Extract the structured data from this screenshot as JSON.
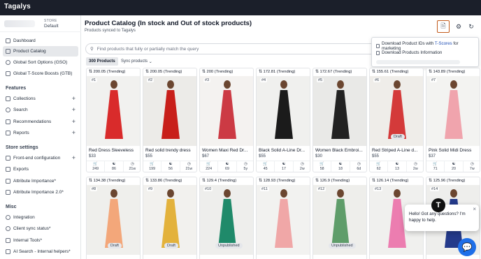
{
  "app": {
    "logo": "Tagalys"
  },
  "store": {
    "caption": "STORE",
    "value": "Default"
  },
  "sidebar": {
    "items": [
      {
        "label": "Dashboard"
      },
      {
        "label": "Product Catalog",
        "active": true
      },
      {
        "label": "Global Sort Options (GSO)"
      },
      {
        "label": "Global T-Score Boosts (GTB)"
      }
    ],
    "features_heading": "Features",
    "features": [
      {
        "label": "Collections"
      },
      {
        "label": "Search"
      },
      {
        "label": "Recommendations"
      },
      {
        "label": "Reports"
      }
    ],
    "settings_heading": "Store settings",
    "settings": [
      {
        "label": "Front-end configuration"
      },
      {
        "label": "Exports"
      },
      {
        "label": "Attribute Importance*"
      },
      {
        "label": "Attribute Importance 2.0*"
      }
    ],
    "misc_heading": "Misc",
    "misc": [
      {
        "label": "Integration"
      },
      {
        "label": "Client sync status*"
      },
      {
        "label": "Internal Tools*"
      },
      {
        "label": "AI Search - Internal helpers*"
      }
    ]
  },
  "header": {
    "title": "Product Catalog (In stock and Out of stock products)",
    "subtitle": "Products synced to Tagalys"
  },
  "dropdown": {
    "item1_prefix": "Download Product IDs with ",
    "item1_highlight": "T-Scores",
    "item1_suffix": " for marketing",
    "item2": "Download Products Information"
  },
  "search": {
    "placeholder": "Find products that fully or partially match the query"
  },
  "toolbar": {
    "count": "300 Products",
    "sync": "Sync products"
  },
  "products": [
    {
      "score": "200.05 (Trending)",
      "rank": "#1",
      "name": "Red Dress Sleeveless",
      "price": "$33",
      "stats": [
        "249",
        "86",
        "21w"
      ],
      "color": "#d92b2b",
      "bg": "#f1f1ef",
      "draft": ""
    },
    {
      "score": "200.05 (Trending)",
      "rank": "#2",
      "name": "Red solid trendy dress",
      "price": "$55",
      "stats": [
        "199",
        "56",
        "21w"
      ],
      "color": "#c81f1a",
      "bg": "#ecebe8",
      "draft": ""
    },
    {
      "score": "200 (Trending)",
      "rank": "#3",
      "name": "Women Maxi Red Dr...",
      "price": "$67",
      "stats": [
        "224",
        "69",
        "5y"
      ],
      "color": "#cc3a44",
      "bg": "#f4f2f0",
      "draft": ""
    },
    {
      "score": "172.81 (Trending)",
      "rank": "#4",
      "name": "Black Solid A-Line Dr...",
      "price": "$55",
      "stats": [
        "45",
        "17",
        "2w"
      ],
      "color": "#1b1b1b",
      "bg": "#f0f0ee",
      "draft": ""
    },
    {
      "score": "172.67 (Trending)",
      "rank": "#5",
      "name": "Women Black Embroi...",
      "price": "$30",
      "stats": [
        "58",
        "18",
        "6d"
      ],
      "color": "#222222",
      "bg": "#e9e9e7",
      "draft": ""
    },
    {
      "score": "155.61 (Trending)",
      "rank": "#6",
      "name": "Red Striped A-Line d...",
      "price": "$55",
      "stats": [
        "62",
        "13",
        "2w"
      ],
      "color": "#d43a3a",
      "bg": "#efede9",
      "draft": "Draft"
    },
    {
      "score": "143.89 (Trending)",
      "rank": "#7",
      "name": "Pink Solid Midi Dress",
      "price": "$37",
      "stats": [
        "71",
        "20",
        "7w"
      ],
      "color": "#f0a4ad",
      "bg": "#f3f3f1",
      "draft": ""
    },
    {
      "score": "134.38 (Trending)",
      "rank": "#8",
      "name": "",
      "price": "",
      "stats": [],
      "color": "#f3a77a",
      "bg": "#efefec",
      "draft": "Draft"
    },
    {
      "score": "133.86 (Trending)",
      "rank": "#9",
      "name": "",
      "price": "",
      "stats": [],
      "color": "#e3b23c",
      "bg": "#f2f1ee",
      "draft": "Draft"
    },
    {
      "score": "129.4 (Trending)",
      "rank": "#10",
      "name": "",
      "price": "",
      "stats": [],
      "color": "#1f8a6a",
      "bg": "#eeeeec",
      "draft": "Unpublished"
    },
    {
      "score": "128.93 (Trending)",
      "rank": "#11",
      "name": "",
      "price": "",
      "stats": [],
      "color": "#f0a7a7",
      "bg": "#f2f2f0",
      "draft": ""
    },
    {
      "score": "126.9 (Trending)",
      "rank": "#12",
      "name": "",
      "price": "",
      "stats": [],
      "color": "#5f9d6a",
      "bg": "#eeeeeb",
      "draft": "Unpublished"
    },
    {
      "score": "126.14 (Trending)",
      "rank": "#13",
      "name": "",
      "price": "",
      "stats": [],
      "color": "#ec7db0",
      "bg": "#f0f0ee",
      "draft": ""
    },
    {
      "score": "125.96 (Trending)",
      "rank": "#14",
      "name": "",
      "price": "",
      "stats": [],
      "color": "#243a8a",
      "bg": "#eeeeec",
      "draft": ""
    }
  ],
  "chat": {
    "message": "Hello! Got any questions? I'm happy to help.",
    "avatar": "T"
  },
  "colors": {
    "topbar": "#1b1f2a",
    "accent_border": "#c25a1b",
    "highlight_link": "#1f4eb5",
    "chat_fab": "#1f6fe8"
  }
}
